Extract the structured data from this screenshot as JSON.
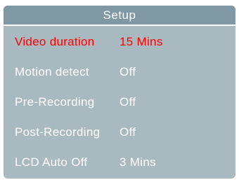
{
  "header": {
    "title": "Setup"
  },
  "colors": {
    "panel": "#a8b9c0",
    "header": "#7f98a3",
    "text": "#ffffff",
    "selected": "#ff0000"
  },
  "menu": {
    "selected_index": 0,
    "items": [
      {
        "label": "Video duration",
        "value": "15 Mins"
      },
      {
        "label": "Motion detect",
        "value": "Off"
      },
      {
        "label": "Pre-Recording",
        "value": "Off"
      },
      {
        "label": "Post-Recording",
        "value": "Off"
      },
      {
        "label": "LCD Auto Off",
        "value": "3 Mins"
      }
    ]
  }
}
